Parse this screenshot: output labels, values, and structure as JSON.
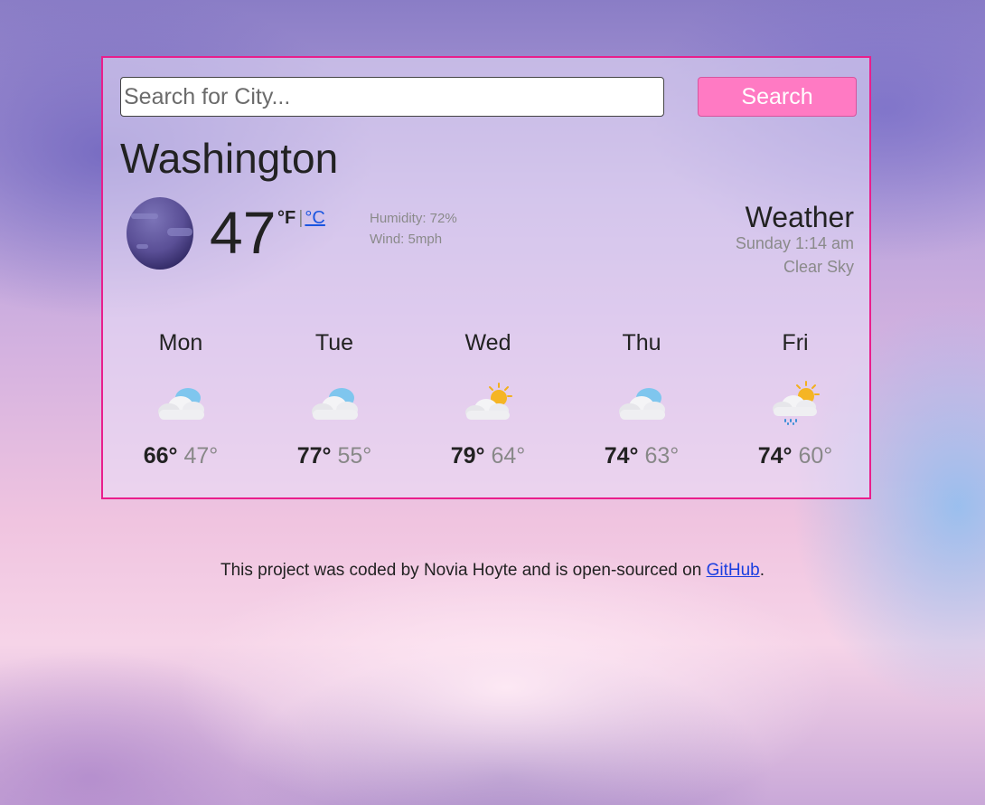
{
  "search": {
    "placeholder": "Search for City...",
    "value": "",
    "button_label": "Search"
  },
  "current": {
    "city": "Washington",
    "icon": "night-moon-icon",
    "temperature": "47",
    "unit_f": "°F",
    "unit_separator": "|",
    "unit_c": "°C",
    "humidity": "Humidity: 72%",
    "wind": "Wind: 5mph",
    "summary_title": "Weather",
    "datetime": "Sunday 1:14 am",
    "description": "Clear Sky"
  },
  "forecast": [
    {
      "day": "Mon",
      "icon": "cloudy-icon",
      "high": "66°",
      "low": "47°"
    },
    {
      "day": "Tue",
      "icon": "cloudy-icon",
      "high": "77°",
      "low": "55°"
    },
    {
      "day": "Wed",
      "icon": "partly-sunny-icon",
      "high": "79°",
      "low": "64°"
    },
    {
      "day": "Thu",
      "icon": "cloudy-icon",
      "high": "74°",
      "low": "63°"
    },
    {
      "day": "Fri",
      "icon": "sun-rain-icon",
      "high": "74°",
      "low": "60°"
    }
  ],
  "footer": {
    "text_before": "This project was coded by Novia Hoyte and is open-sourced on ",
    "link_label": "GitHub",
    "text_after": "."
  },
  "colors": {
    "card_border": "#e91e8c",
    "search_button": "#ff7ac3",
    "link": "#1a55e0"
  }
}
